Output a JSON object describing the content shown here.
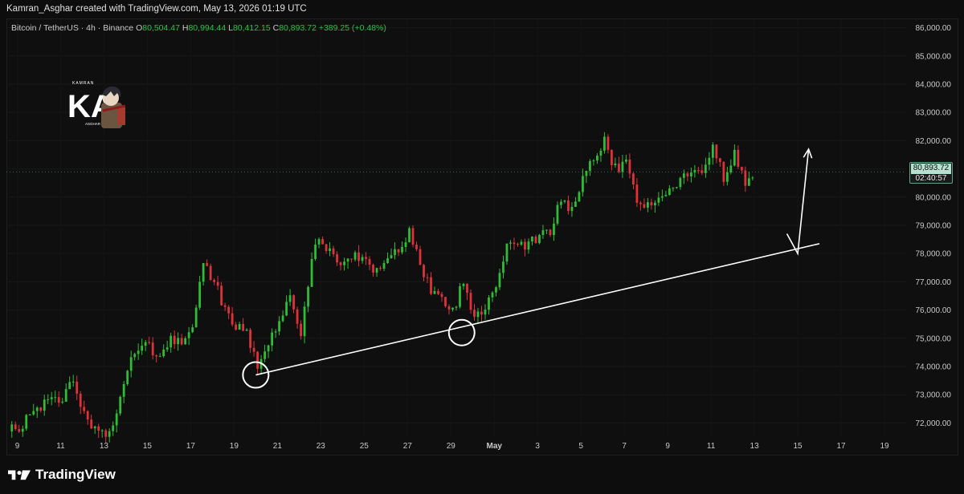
{
  "header": {
    "attribution": "Kamran_Asghar created with TradingView.com, May 13, 2026 01:19 UTC"
  },
  "legend": {
    "symbol": "Bitcoin / TetherUS · 4h · Binance",
    "open_label": "O",
    "open": "80,504.47",
    "high_label": "H",
    "high": "80,994.44",
    "low_label": "L",
    "low": "80,412.15",
    "close_label": "C",
    "close": "80,893.72",
    "change": "+389.25 (+0.48%)"
  },
  "logo": {
    "letters": "KA",
    "top_text": "KAMRAN",
    "bottom_text": "ASGHAR"
  },
  "price_tag": {
    "price": "80,893.72",
    "countdown": "02:40:57"
  },
  "brand": {
    "name": "TradingView"
  },
  "colors": {
    "up": "#2ebd34",
    "down": "#e0313b",
    "background": "#0f0f0f",
    "annotation": "#ffffff"
  },
  "chart_data": {
    "type": "candlestick",
    "title": "",
    "timeframe": "4h",
    "ylim": [
      71500,
      86300
    ],
    "y_ticks": [
      72000,
      73000,
      74000,
      75000,
      76000,
      77000,
      78000,
      79000,
      80000,
      81000,
      82000,
      83000,
      84000,
      85000,
      86000
    ],
    "y_tick_labels": [
      "72,000.00",
      "73,000.00",
      "74,000.00",
      "75,000.00",
      "76,000.00",
      "77,000.00",
      "78,000.00",
      "79,000.00",
      "80,000.00",
      "81,000.00",
      "82,000.00",
      "83,000.00",
      "84,000.00",
      "85,000.00",
      "86,000.00"
    ],
    "x_range_days": [
      "2026-04-08T12:00",
      "2026-05-20T00:00"
    ],
    "x_ticks": [
      {
        "date": "2026-04-09",
        "label": "9"
      },
      {
        "date": "2026-04-11",
        "label": "11"
      },
      {
        "date": "2026-04-13",
        "label": "13"
      },
      {
        "date": "2026-04-15",
        "label": "15"
      },
      {
        "date": "2026-04-17",
        "label": "17"
      },
      {
        "date": "2026-04-19",
        "label": "19"
      },
      {
        "date": "2026-04-21",
        "label": "21"
      },
      {
        "date": "2026-04-23",
        "label": "23"
      },
      {
        "date": "2026-04-25",
        "label": "25"
      },
      {
        "date": "2026-04-27",
        "label": "27"
      },
      {
        "date": "2026-04-29",
        "label": "29"
      },
      {
        "date": "2026-05-01",
        "label": "May"
      },
      {
        "date": "2026-05-03",
        "label": "3"
      },
      {
        "date": "2026-05-05",
        "label": "5"
      },
      {
        "date": "2026-05-07",
        "label": "7"
      },
      {
        "date": "2026-05-09",
        "label": "9"
      },
      {
        "date": "2026-05-11",
        "label": "11"
      },
      {
        "date": "2026-05-13",
        "label": "13"
      },
      {
        "date": "2026-05-15",
        "label": "15"
      },
      {
        "date": "2026-05-17",
        "label": "17"
      },
      {
        "date": "2026-05-19",
        "label": "19"
      }
    ],
    "price_anchors": [
      [
        "2026-04-08T18:00",
        71700
      ],
      [
        "2026-04-09T06:00",
        71900
      ],
      [
        "2026-04-09T18:00",
        72200
      ],
      [
        "2026-04-10T06:00",
        72600
      ],
      [
        "2026-04-10T18:00",
        73000
      ],
      [
        "2026-04-11T06:00",
        72800
      ],
      [
        "2026-04-11T18:00",
        73500
      ],
      [
        "2026-04-12T06:00",
        72400
      ],
      [
        "2026-04-12T18:00",
        71700
      ],
      [
        "2026-04-13T06:00",
        71600
      ],
      [
        "2026-04-13T18:00",
        72300
      ],
      [
        "2026-04-14T06:00",
        74000
      ],
      [
        "2026-04-14T18:00",
        74500
      ],
      [
        "2026-04-15T06:00",
        74800
      ],
      [
        "2026-04-15T18:00",
        74200
      ],
      [
        "2026-04-16T06:00",
        75000
      ],
      [
        "2026-04-16T18:00",
        74900
      ],
      [
        "2026-04-17T06:00",
        75400
      ],
      [
        "2026-04-17T18:00",
        77800
      ],
      [
        "2026-04-18T06:00",
        77000
      ],
      [
        "2026-04-18T18:00",
        76000
      ],
      [
        "2026-04-19T06:00",
        75500
      ],
      [
        "2026-04-19T18:00",
        75100
      ],
      [
        "2026-04-20T06:00",
        74000
      ],
      [
        "2026-04-20T18:00",
        74700
      ],
      [
        "2026-04-21T06:00",
        75700
      ],
      [
        "2026-04-21T18:00",
        76500
      ],
      [
        "2026-04-22T06:00",
        75000
      ],
      [
        "2026-04-22T18:00",
        78000
      ],
      [
        "2026-04-23T06:00",
        78500
      ],
      [
        "2026-04-23T18:00",
        77800
      ],
      [
        "2026-04-24T06:00",
        77600
      ],
      [
        "2026-04-24T18:00",
        77900
      ],
      [
        "2026-04-25T06:00",
        77600
      ],
      [
        "2026-04-25T18:00",
        77400
      ],
      [
        "2026-04-26T06:00",
        77700
      ],
      [
        "2026-04-26T18:00",
        78200
      ],
      [
        "2026-04-27T06:00",
        78700
      ],
      [
        "2026-04-27T18:00",
        77700
      ],
      [
        "2026-04-28T06:00",
        76600
      ],
      [
        "2026-04-28T18:00",
        76300
      ],
      [
        "2026-04-29T06:00",
        75900
      ],
      [
        "2026-04-29T18:00",
        77100
      ],
      [
        "2026-04-30T06:00",
        75600
      ],
      [
        "2026-04-30T18:00",
        76100
      ],
      [
        "2026-05-01T06:00",
        76700
      ],
      [
        "2026-05-01T18:00",
        78500
      ],
      [
        "2026-05-02T06:00",
        78400
      ],
      [
        "2026-05-02T18:00",
        78300
      ],
      [
        "2026-05-03T06:00",
        78600
      ],
      [
        "2026-05-03T18:00",
        78800
      ],
      [
        "2026-05-04T06:00",
        80000
      ],
      [
        "2026-05-04T18:00",
        79500
      ],
      [
        "2026-05-05T06:00",
        80800
      ],
      [
        "2026-05-05T18:00",
        81500
      ],
      [
        "2026-05-06T06:00",
        82000
      ],
      [
        "2026-05-06T18:00",
        81000
      ],
      [
        "2026-05-07T06:00",
        81200
      ],
      [
        "2026-05-07T18:00",
        80000
      ],
      [
        "2026-05-08T06:00",
        79700
      ],
      [
        "2026-05-08T18:00",
        80100
      ],
      [
        "2026-05-09T06:00",
        80300
      ],
      [
        "2026-05-09T18:00",
        80600
      ],
      [
        "2026-05-10T06:00",
        80900
      ],
      [
        "2026-05-10T18:00",
        80800
      ],
      [
        "2026-05-11T06:00",
        81800
      ],
      [
        "2026-05-11T18:00",
        80700
      ],
      [
        "2026-05-12T06:00",
        81600
      ],
      [
        "2026-05-12T18:00",
        80400
      ],
      [
        "2026-05-13T00:00",
        80894
      ]
    ],
    "last_price": 80893.72,
    "annotations": {
      "trendline": {
        "from": [
          "2026-04-20T00:00",
          73700
        ],
        "to": [
          "2026-05-16T00:00",
          78350
        ]
      },
      "circles": [
        {
          "center": [
            "2026-04-20T00:00",
            73700
          ]
        },
        {
          "center": [
            "2026-04-29T12:00",
            75200
          ]
        }
      ],
      "arrow_path": [
        [
          "2026-05-14T12:00",
          78700
        ],
        [
          "2026-05-15T00:00",
          78000
        ],
        [
          "2026-05-15T12:00",
          81700
        ]
      ]
    }
  }
}
